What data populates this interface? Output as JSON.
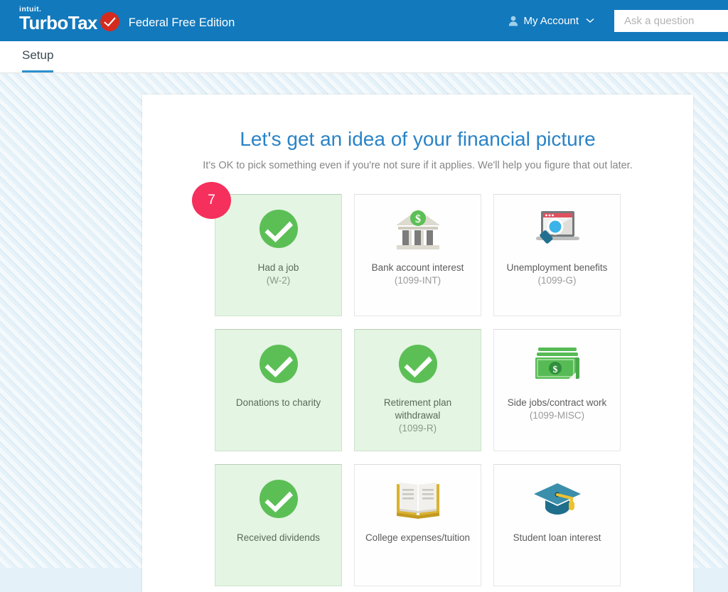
{
  "header": {
    "brand_intuit": "intuit.",
    "brand_product": "TurboTax",
    "edition": "Federal Free Edition",
    "account_label": "My Account",
    "account_icon": "person-icon",
    "account_chevron_icon": "chevron-down-icon",
    "search_placeholder": "Ask a question",
    "search_value": "",
    "background_color": "#1279bd",
    "check_badge_color": "#d52b1e"
  },
  "tabs": [
    {
      "label": "Setup",
      "active": true
    }
  ],
  "main": {
    "title": "Let's get an idea of your financial picture",
    "subtitle": "It's OK to pick something even if you're not sure if it applies. We'll help you figure that out later.",
    "title_color": "#2a83c7",
    "badge": {
      "value": "7",
      "color": "#f5305d"
    }
  },
  "cards": [
    {
      "label": "Had a job",
      "form": "(W-2)",
      "selected": true,
      "icon": "green-check-icon"
    },
    {
      "label": "Bank account interest",
      "form": "(1099-INT)",
      "selected": false,
      "icon": "bank-icon"
    },
    {
      "label": "Unemployment benefits",
      "form": "(1099-G)",
      "selected": false,
      "icon": "laptop-search-icon"
    },
    {
      "label": "Donations to charity",
      "form": "",
      "selected": true,
      "icon": "green-check-icon"
    },
    {
      "label": "Retirement plan withdrawal",
      "form": "(1099-R)",
      "selected": true,
      "icon": "green-check-icon"
    },
    {
      "label": "Side jobs/contract work",
      "form": "(1099-MISC)",
      "selected": false,
      "icon": "money-stack-icon"
    },
    {
      "label": "Received dividends",
      "form": "",
      "selected": true,
      "icon": "green-check-icon"
    },
    {
      "label": "College expenses/tuition",
      "form": "",
      "selected": false,
      "icon": "open-book-icon"
    },
    {
      "label": "Student loan interest",
      "form": "",
      "selected": false,
      "icon": "graduation-cap-icon"
    }
  ],
  "colors": {
    "check_green": "#5cbf56",
    "money_green": "#57bb55",
    "book_gold": "#dbb22e",
    "cap_teal": "#2e7f9b",
    "bank_stone": "#d9d6cb"
  }
}
